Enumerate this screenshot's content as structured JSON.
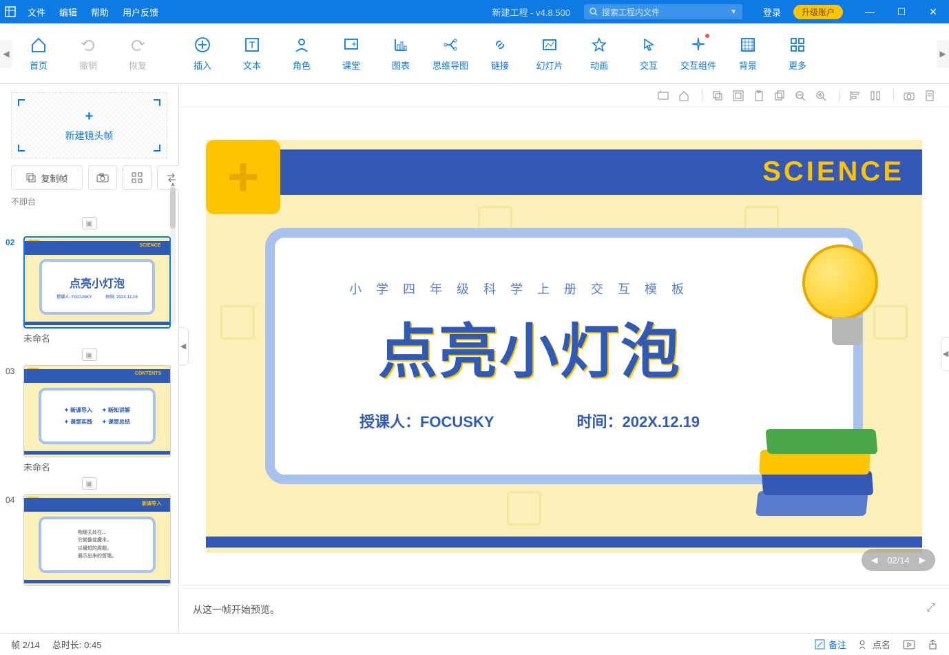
{
  "title_bar": {
    "menus": [
      "文件",
      "编辑",
      "帮助",
      "用户反馈"
    ],
    "title": "新建工程 - v4.8.500",
    "search_placeholder": "搜索工程内文件",
    "login": "登录",
    "upgrade": "升级账户"
  },
  "ribbon": {
    "items": [
      {
        "label": "首页",
        "icon": "home-icon",
        "disabled": false
      },
      {
        "label": "撤销",
        "icon": "undo-icon",
        "disabled": true
      },
      {
        "label": "恢复",
        "icon": "redo-icon",
        "disabled": true
      },
      {
        "sep": true
      },
      {
        "label": "插入",
        "icon": "plus-circle-icon"
      },
      {
        "label": "文本",
        "icon": "text-icon"
      },
      {
        "label": "角色",
        "icon": "person-icon"
      },
      {
        "label": "课堂",
        "icon": "board-plus-icon"
      },
      {
        "label": "图表",
        "icon": "chart-icon"
      },
      {
        "label": "思维导图",
        "icon": "mindmap-icon"
      },
      {
        "label": "链接",
        "icon": "link-icon"
      },
      {
        "label": "幻灯片",
        "icon": "slide-icon"
      },
      {
        "label": "动画",
        "icon": "star-icon"
      },
      {
        "label": "交互",
        "icon": "cursor-icon"
      },
      {
        "label": "交互组件",
        "icon": "spark-icon",
        "notify": true
      },
      {
        "label": "背景",
        "icon": "pattern-icon"
      },
      {
        "label": "更多",
        "icon": "grid-icon"
      }
    ]
  },
  "left_panel": {
    "new_frame_label": "新建镜头帧",
    "copy_frame_label": "复制帧",
    "extra_label": "不即台",
    "slides": [
      {
        "num": "02",
        "name": "未命名",
        "active": true,
        "title": "点亮小灯泡",
        "tag": "SCIENCE"
      },
      {
        "num": "03",
        "name": "未命名",
        "active": false,
        "title": "",
        "tag": "CONTENTS",
        "items": [
          "新课导入",
          "新知讲解",
          "课堂实践",
          "课堂总结"
        ]
      },
      {
        "num": "04",
        "name": "",
        "active": false,
        "title": "",
        "tag": "新课导入"
      }
    ]
  },
  "canvas": {
    "science_label": "SCIENCE",
    "subtitle": "小 学 四 年 级 科 学 上 册 交 互 模 板",
    "title": "点亮小灯泡",
    "teacher_label": "授课人：FOCUSKY",
    "time_label": "时间：202X.12.19",
    "pager": {
      "current": "02",
      "total": "14"
    }
  },
  "preview_bar": {
    "text": "从这一帧开始预览。"
  },
  "status_bar": {
    "frame_label": "帧 2/14",
    "duration_label": "总时长: 0:45",
    "notes_label": "备注",
    "name_label": "点名"
  }
}
